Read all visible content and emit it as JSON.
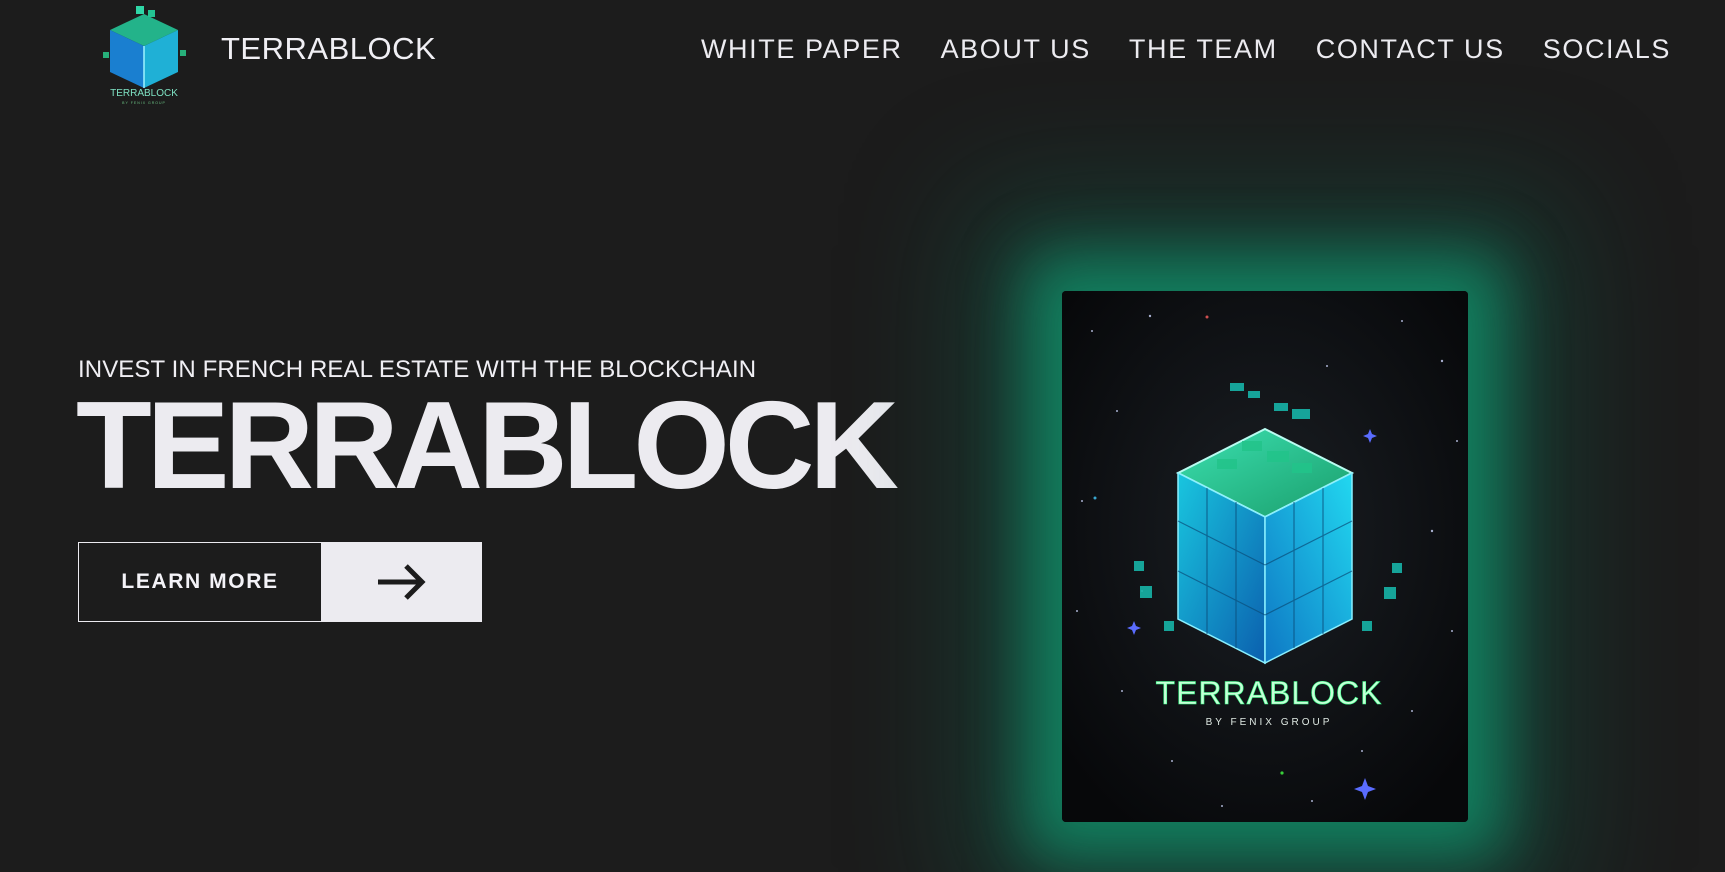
{
  "header": {
    "brand_name": "TERRABLOCK",
    "logo_icon": "terrablock-cube-logo",
    "nav": [
      {
        "label": "WHITE PAPER"
      },
      {
        "label": "ABOUT US"
      },
      {
        "label": "THE TEAM"
      },
      {
        "label": "CONTACT US"
      },
      {
        "label": "SOCIALS"
      }
    ]
  },
  "hero": {
    "subtitle": "INVEST IN FRENCH REAL ESTATE WITH THE BLOCKCHAIN",
    "title": "TERRABLOCK",
    "cta_label": "LEARN MORE",
    "cta_icon": "arrow-right-icon"
  },
  "artwork": {
    "title": "TERRABLOCK",
    "byline": "BY FENIX GROUP",
    "logo_tagline": "BY FENIX GROUP"
  },
  "colors": {
    "background": "#1c1c1c",
    "text": "#ecebf0",
    "glow": "#10966e",
    "cube_cyan": "#19c6df",
    "cube_green": "#1fb66a"
  }
}
